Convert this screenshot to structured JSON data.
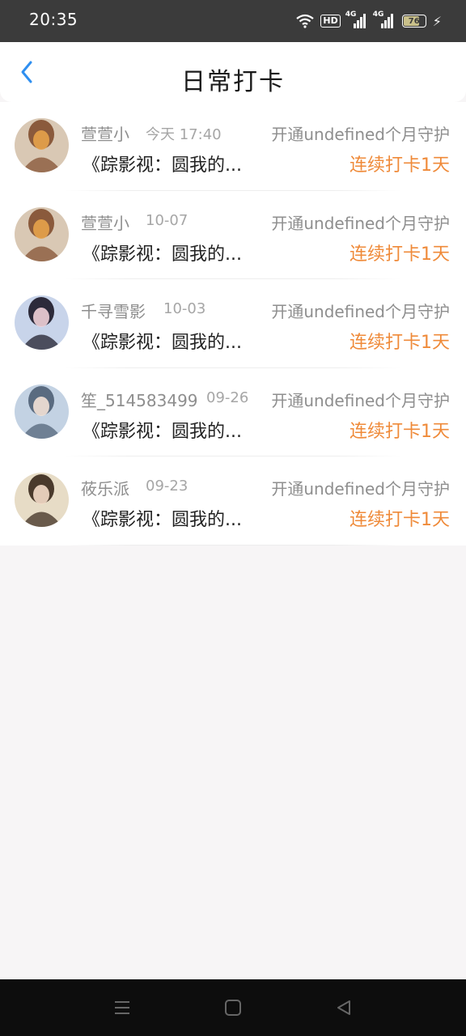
{
  "status_bar": {
    "time": "20:35",
    "hd_label": "HD",
    "sim1_label": "4G",
    "sim2_label": "4G",
    "battery_level": 76,
    "battery_label": "76"
  },
  "header": {
    "title": "日常打卡",
    "back_icon": "chevron-left-icon",
    "accent_color": "#2f8ff0"
  },
  "checkins": [
    {
      "username": "萱萱小",
      "date": "今天 17:40",
      "subscription": "开通undefined个月守护",
      "content": "《踪影视：圆我的...",
      "streak": "连续打卡1天"
    },
    {
      "username": "萱萱小",
      "date": "10-07",
      "subscription": "开通undefined个月守护",
      "content": "《踪影视：圆我的...",
      "streak": "连续打卡1天"
    },
    {
      "username": "千寻雪影",
      "date": "10-03",
      "subscription": "开通undefined个月守护",
      "content": "《踪影视：圆我的...",
      "streak": "连续打卡1天"
    },
    {
      "username": "笙_514583499",
      "date": "09-26",
      "subscription": "开通undefined个月守护",
      "content": "《踪影视：圆我的...",
      "streak": "连续打卡1天"
    },
    {
      "username": "莜乐派",
      "date": "09-23",
      "subscription": "开通undefined个月守护",
      "content": "《踪影视：圆我的...",
      "streak": "连续打卡1天"
    }
  ],
  "colors": {
    "streak": "#ef8a39",
    "meta_text": "#8e8e8e"
  },
  "nav_bar": {
    "buttons": [
      "menu-icon",
      "home-square-icon",
      "back-triangle-icon"
    ]
  }
}
